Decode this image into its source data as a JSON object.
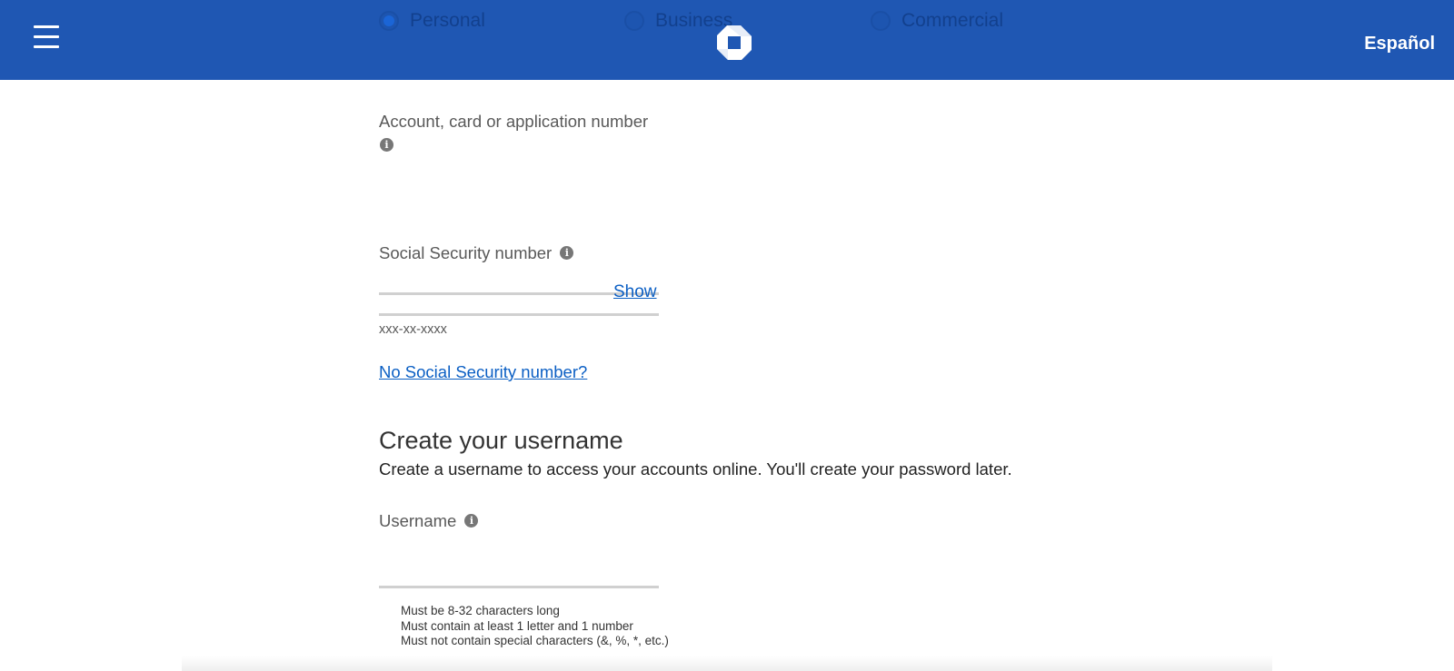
{
  "header": {
    "account_types": [
      {
        "label": "Personal",
        "selected": true
      },
      {
        "label": "Business",
        "selected": false
      },
      {
        "label": "Commercial",
        "selected": false
      }
    ],
    "language_link": "Español",
    "menu_icon": "hamburger-menu-icon",
    "logo_icon": "chase-octagon-logo",
    "colors": {
      "header_bg": "#1f57b3",
      "link": "#0b5fc4"
    }
  },
  "form": {
    "account_number": {
      "label": "Account, card or application number",
      "value": ""
    },
    "ssn": {
      "label": "Social Security number",
      "value": "",
      "show_label": "Show",
      "format_hint": "xxx-xx-xxxx",
      "no_ssn_link": "No Social Security number?"
    },
    "username_section": {
      "title": "Create your username",
      "description": "Create a username to access your accounts online. You'll create your password later.",
      "label": "Username",
      "value": "",
      "rules": [
        "Must be 8-32 characters long",
        "Must contain at least 1 letter and 1 number",
        "Must not contain special characters (&, %, *, etc.)"
      ]
    }
  }
}
